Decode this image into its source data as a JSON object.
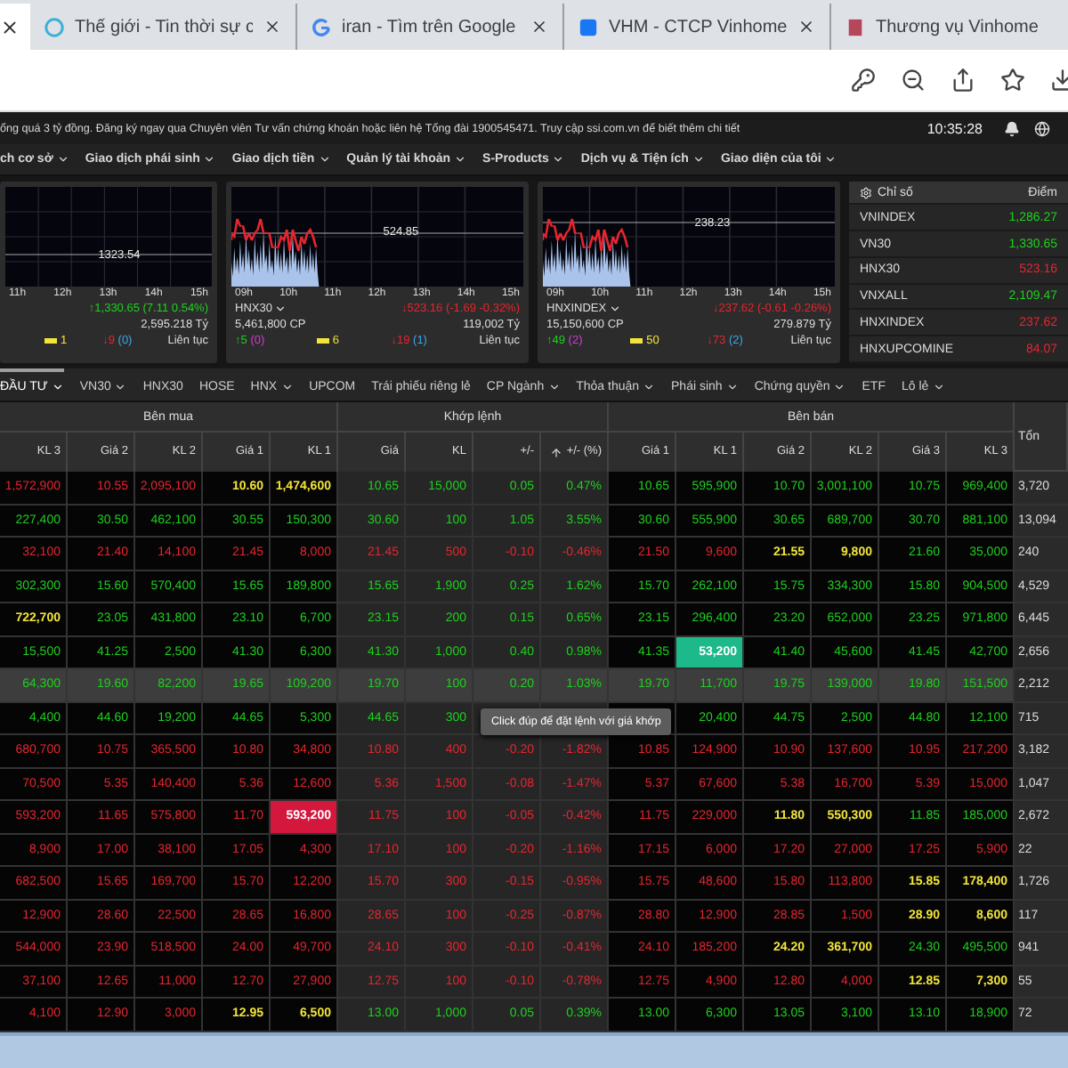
{
  "browser": {
    "tabs": [
      {
        "title": "Thế giới - Tin thời sự c"
      },
      {
        "title": "iran - Tìm trên Google"
      },
      {
        "title": "VHM - CTCP Vinhome"
      },
      {
        "title": "Thương vụ Vinhome"
      }
    ]
  },
  "ticker": {
    "text": "ổng quá 3 tỷ đồng. Đăng ký ngay qua Chuyên viên Tư vấn chứng khoán hoặc liên hệ Tổng đài 1900545471. Truy cập ssi.com.vn để biết thêm chi tiết",
    "time": "10:35:28"
  },
  "menu": [
    "ch cơ sở",
    "Giao dịch phái sinh",
    "Giao dịch tiền",
    "Quản lý tài khoản",
    "S-Products",
    "Dịch vụ & Tiện ích",
    "Giao diện của tôi"
  ],
  "charts": [
    {
      "reference": "1323.54",
      "hours": [
        "11h",
        "12h",
        "13h",
        "14h",
        "15h"
      ],
      "color": "#1fd01f",
      "change": "↑1,330.65 (7.11 0.54%)",
      "value": "2,595.218 Tỷ",
      "unchanged": "1",
      "declines": "↓9",
      "declines_floor": "(0)",
      "status": "Liên tục"
    },
    {
      "reference": "524.85",
      "hours": [
        "09h",
        "10h",
        "11h",
        "12h",
        "13h",
        "14h",
        "15h"
      ],
      "name": "HNX30",
      "color": "#e5262f",
      "change": "↓523.16 (-1.69 -0.32%)",
      "volume": "5,461,800 CP",
      "value": "119,002 Tỷ",
      "advances": "↑5",
      "advances_ceiling": "(0)",
      "unchanged": "6",
      "declines": "↓19",
      "declines_floor": "(1)",
      "status": "Liên tục"
    },
    {
      "reference": "238.23",
      "hours": [
        "09h",
        "10h",
        "11h",
        "12h",
        "13h",
        "14h",
        "15h"
      ],
      "name": "HNXINDEX",
      "color": "#e5262f",
      "change": "↓237.62 (-0.61 -0.26%)",
      "volume": "15,150,600 CP",
      "value": "279.879 Tỷ",
      "advances": "↑49",
      "advances_ceiling": "(2)",
      "unchanged": "50",
      "declines": "↓73",
      "declines_floor": "(2)",
      "status": "Liên tục"
    }
  ],
  "indices": {
    "header": [
      "Chỉ số",
      "Điểm"
    ],
    "rows": [
      {
        "name": "VNINDEX",
        "value": "1,286.27",
        "color": "#1fd01f"
      },
      {
        "name": "VN30",
        "value": "1,330.65",
        "color": "#1fd01f"
      },
      {
        "name": "HNX30",
        "value": "523.16",
        "color": "#e5262f"
      },
      {
        "name": "VNXALL",
        "value": "2,109.47",
        "color": "#1fd01f"
      },
      {
        "name": "HNXINDEX",
        "value": "237.62",
        "color": "#e5262f"
      },
      {
        "name": "HNXUPCOMINE",
        "value": "84.07",
        "color": "#e5262f"
      }
    ]
  },
  "board": {
    "tabs": [
      {
        "label": "ĐẦU TƯ",
        "dropdown": true,
        "selected": true
      },
      {
        "label": "VN30",
        "dropdown": true,
        "selected": false
      },
      {
        "label": "HNX30",
        "dropdown": false,
        "selected": false
      },
      {
        "label": "HOSE",
        "dropdown": false,
        "selected": false
      },
      {
        "label": "HNX",
        "dropdown": true,
        "selected": false
      },
      {
        "label": "UPCOM",
        "dropdown": false,
        "selected": false
      },
      {
        "label": "Trái phiếu riêng lẻ",
        "dropdown": false,
        "selected": false
      },
      {
        "label": "CP Ngành",
        "dropdown": true,
        "selected": false
      },
      {
        "label": "Thỏa thuận",
        "dropdown": true,
        "selected": false
      },
      {
        "label": "Phái sinh",
        "dropdown": true,
        "selected": false
      },
      {
        "label": "Chứng quyền",
        "dropdown": true,
        "selected": false
      },
      {
        "label": "ETF",
        "dropdown": false,
        "selected": false
      },
      {
        "label": "Lô lẻ",
        "dropdown": true,
        "selected": false
      }
    ],
    "groups": [
      "Bên mua",
      "Khớp lệnh",
      "Bên bán",
      "Tổn"
    ],
    "columns": [
      "KL 3",
      "Giá 2",
      "KL 2",
      "Giá 1",
      "KL 1",
      "Giá",
      "KL",
      "+/-",
      "+/- (%)",
      "Giá 1",
      "KL 1",
      "Giá 2",
      "KL 2",
      "Giá 3",
      "KL 3"
    ],
    "rows": [
      {
        "selected": false,
        "bid": [
          {
            "volume": "1,572,900",
            "color": "#e5262f"
          },
          {
            "price": "10.55",
            "volume": "2,095,100",
            "color": "#e5262f"
          },
          {
            "price": "10.60",
            "volume": "1,474,600",
            "color": "#f2e43a"
          }
        ],
        "match": {
          "price": "10.65",
          "volume": "15,000",
          "change": "0.05",
          "percent": "0.47%",
          "color": "#1fd01f"
        },
        "ask": [
          {
            "price": "10.65",
            "volume": "595,900",
            "color": "#1fd01f"
          },
          {
            "price": "10.70",
            "volume": "3,001,100",
            "color": "#1fd01f"
          },
          {
            "price": "10.75",
            "volume": "969,400",
            "color": "#1fd01f"
          }
        ],
        "total": "3,720"
      },
      {
        "selected": false,
        "bid": [
          {
            "volume": "227,400",
            "color": "#1fd01f"
          },
          {
            "price": "30.50",
            "volume": "462,100",
            "color": "#1fd01f"
          },
          {
            "price": "30.55",
            "volume": "150,300",
            "color": "#1fd01f"
          }
        ],
        "match": {
          "price": "30.60",
          "volume": "100",
          "change": "1.05",
          "percent": "3.55%",
          "color": "#1fd01f"
        },
        "ask": [
          {
            "price": "30.60",
            "volume": "555,900",
            "color": "#1fd01f"
          },
          {
            "price": "30.65",
            "volume": "689,700",
            "color": "#1fd01f"
          },
          {
            "price": "30.70",
            "volume": "881,100",
            "color": "#1fd01f"
          }
        ],
        "total": "13,094"
      },
      {
        "selected": false,
        "bid": [
          {
            "volume": "32,100",
            "color": "#e5262f"
          },
          {
            "price": "21.40",
            "volume": "14,100",
            "color": "#e5262f"
          },
          {
            "price": "21.45",
            "volume": "8,000",
            "color": "#e5262f"
          }
        ],
        "match": {
          "price": "21.45",
          "volume": "500",
          "change": "-0.10",
          "percent": "-0.46%",
          "color": "#e5262f"
        },
        "ask": [
          {
            "price": "21.50",
            "volume": "9,600",
            "color": "#e5262f"
          },
          {
            "price": "21.55",
            "volume": "9,800",
            "color": "#f2e43a"
          },
          {
            "price": "21.60",
            "volume": "35,000",
            "color": "#1fd01f"
          }
        ],
        "total": "240"
      },
      {
        "selected": false,
        "bid": [
          {
            "volume": "302,300",
            "color": "#1fd01f"
          },
          {
            "price": "15.60",
            "volume": "570,400",
            "color": "#1fd01f"
          },
          {
            "price": "15.65",
            "volume": "189,800",
            "color": "#1fd01f"
          }
        ],
        "match": {
          "price": "15.65",
          "volume": "1,900",
          "change": "0.25",
          "percent": "1.62%",
          "color": "#1fd01f"
        },
        "ask": [
          {
            "price": "15.70",
            "volume": "262,100",
            "color": "#1fd01f"
          },
          {
            "price": "15.75",
            "volume": "334,300",
            "color": "#1fd01f"
          },
          {
            "price": "15.80",
            "volume": "904,500",
            "color": "#1fd01f"
          }
        ],
        "total": "4,529"
      },
      {
        "selected": false,
        "bid": [
          {
            "volume": "722,700",
            "color": "#f2e43a"
          },
          {
            "price": "23.05",
            "volume": "431,800",
            "color": "#1fd01f"
          },
          {
            "price": "23.10",
            "volume": "6,700",
            "color": "#1fd01f"
          }
        ],
        "match": {
          "price": "23.15",
          "volume": "200",
          "change": "0.15",
          "percent": "0.65%",
          "color": "#1fd01f"
        },
        "ask": [
          {
            "price": "23.15",
            "volume": "296,400",
            "color": "#1fd01f"
          },
          {
            "price": "23.20",
            "volume": "652,000",
            "color": "#1fd01f"
          },
          {
            "price": "23.25",
            "volume": "971,800",
            "color": "#1fd01f"
          }
        ],
        "total": "6,445"
      },
      {
        "selected": false,
        "bid": [
          {
            "volume": "15,500",
            "color": "#1fd01f"
          },
          {
            "price": "41.25",
            "volume": "2,500",
            "color": "#1fd01f"
          },
          {
            "price": "41.30",
            "volume": "6,300",
            "color": "#1fd01f"
          }
        ],
        "match": {
          "price": "41.30",
          "volume": "1,000",
          "change": "0.40",
          "percent": "0.98%",
          "color": "#1fd01f"
        },
        "ask": [
          {
            "price": "41.35",
            "volume": "53,200",
            "color": "#1fd01f",
            "highlight": {
              "color": "#1db98b"
            }
          },
          {
            "price": "41.40",
            "volume": "45,600",
            "color": "#1fd01f"
          },
          {
            "price": "41.45",
            "volume": "42,700",
            "color": "#1fd01f"
          }
        ],
        "total": "2,656"
      },
      {
        "selected": true,
        "bid": [
          {
            "volume": "64,300",
            "color": "#1fd01f"
          },
          {
            "price": "19.60",
            "volume": "82,200",
            "color": "#1fd01f"
          },
          {
            "price": "19.65",
            "volume": "109,200",
            "color": "#1fd01f"
          }
        ],
        "match": {
          "price": "19.70",
          "volume": "100",
          "change": "0.20",
          "percent": "1.03%",
          "color": "#1fd01f"
        },
        "ask": [
          {
            "price": "19.70",
            "volume": "11,700",
            "color": "#1fd01f"
          },
          {
            "price": "19.75",
            "volume": "139,000",
            "color": "#1fd01f"
          },
          {
            "price": "19.80",
            "volume": "151,500",
            "color": "#1fd01f"
          }
        ],
        "total": "2,212"
      },
      {
        "selected": false,
        "tooltip": "Click đúp để đặt lệnh với giá khớp",
        "bid": [
          {
            "volume": "4,400",
            "color": "#1fd01f"
          },
          {
            "price": "44.60",
            "volume": "19,200",
            "color": "#1fd01f"
          },
          {
            "price": "44.65",
            "volume": "5,300",
            "color": "#1fd01f"
          }
        ],
        "match": {
          "price": "44.65",
          "volume": "300",
          "color": "#1fd01f"
        },
        "ask": [
          {
            "volume": "20,400",
            "color": "#1fd01f"
          },
          {
            "price": "44.75",
            "volume": "2,500",
            "color": "#1fd01f"
          },
          {
            "price": "44.80",
            "volume": "12,100",
            "color": "#1fd01f"
          }
        ],
        "total": "715"
      },
      {
        "selected": false,
        "bid": [
          {
            "volume": "680,700",
            "color": "#e5262f"
          },
          {
            "price": "10.75",
            "volume": "365,500",
            "color": "#e5262f"
          },
          {
            "price": "10.80",
            "volume": "34,800",
            "color": "#e5262f"
          }
        ],
        "match": {
          "price": "10.80",
          "volume": "400",
          "change": "-0.20",
          "percent": "-1.82%",
          "color": "#e5262f"
        },
        "ask": [
          {
            "price": "10.85",
            "volume": "124,900",
            "color": "#e5262f"
          },
          {
            "price": "10.90",
            "volume": "137,600",
            "color": "#e5262f"
          },
          {
            "price": "10.95",
            "volume": "217,200",
            "color": "#e5262f"
          }
        ],
        "total": "3,182"
      },
      {
        "selected": false,
        "bid": [
          {
            "volume": "70,500",
            "color": "#e5262f"
          },
          {
            "price": "5.35",
            "volume": "140,400",
            "color": "#e5262f"
          },
          {
            "price": "5.36",
            "volume": "12,600",
            "color": "#e5262f"
          }
        ],
        "match": {
          "price": "5.36",
          "volume": "1,500",
          "change": "-0.08",
          "percent": "-1.47%",
          "color": "#e5262f"
        },
        "ask": [
          {
            "price": "5.37",
            "volume": "67,600",
            "color": "#e5262f"
          },
          {
            "price": "5.38",
            "volume": "16,700",
            "color": "#e5262f"
          },
          {
            "price": "5.39",
            "volume": "15,000",
            "color": "#e5262f"
          }
        ],
        "total": "1,047"
      },
      {
        "selected": false,
        "bid": [
          {
            "volume": "593,200",
            "color": "#e5262f"
          },
          {
            "price": "11.65",
            "volume": "575,800",
            "color": "#e5262f"
          },
          {
            "price": "11.70",
            "volume": "593,200",
            "color": "#e5262f",
            "highlight": {
              "color": "#d3173d"
            }
          }
        ],
        "match": {
          "price": "11.75",
          "volume": "100",
          "change": "-0.05",
          "percent": "-0.42%",
          "color": "#e5262f"
        },
        "ask": [
          {
            "price": "11.75",
            "volume": "229,000",
            "color": "#e5262f"
          },
          {
            "price": "11.80",
            "volume": "550,300",
            "color": "#f2e43a"
          },
          {
            "price": "11.85",
            "volume": "185,000",
            "color": "#1fd01f"
          }
        ],
        "total": "2,672"
      },
      {
        "selected": false,
        "bid": [
          {
            "volume": "8,900",
            "color": "#e5262f"
          },
          {
            "price": "17.00",
            "volume": "38,100",
            "color": "#e5262f"
          },
          {
            "price": "17.05",
            "volume": "4,300",
            "color": "#e5262f"
          }
        ],
        "match": {
          "price": "17.10",
          "volume": "100",
          "change": "-0.20",
          "percent": "-1.16%",
          "color": "#e5262f"
        },
        "ask": [
          {
            "price": "17.15",
            "volume": "6,000",
            "color": "#e5262f"
          },
          {
            "price": "17.20",
            "volume": "27,000",
            "color": "#e5262f"
          },
          {
            "price": "17.25",
            "volume": "5,900",
            "color": "#e5262f"
          }
        ],
        "total": "22"
      },
      {
        "selected": false,
        "bid": [
          {
            "volume": "682,500",
            "color": "#e5262f"
          },
          {
            "price": "15.65",
            "volume": "169,700",
            "color": "#e5262f"
          },
          {
            "price": "15.70",
            "volume": "12,200",
            "color": "#e5262f"
          }
        ],
        "match": {
          "price": "15.70",
          "volume": "300",
          "change": "-0.15",
          "percent": "-0.95%",
          "color": "#e5262f"
        },
        "ask": [
          {
            "price": "15.75",
            "volume": "48,600",
            "color": "#e5262f"
          },
          {
            "price": "15.80",
            "volume": "113,800",
            "color": "#e5262f"
          },
          {
            "price": "15.85",
            "volume": "178,400",
            "color": "#f2e43a"
          }
        ],
        "total": "1,726"
      },
      {
        "selected": false,
        "bid": [
          {
            "volume": "12,900",
            "color": "#e5262f"
          },
          {
            "price": "28.60",
            "volume": "22,500",
            "color": "#e5262f"
          },
          {
            "price": "28.65",
            "volume": "16,800",
            "color": "#e5262f"
          }
        ],
        "match": {
          "price": "28.65",
          "volume": "100",
          "change": "-0.25",
          "percent": "-0.87%",
          "color": "#e5262f"
        },
        "ask": [
          {
            "price": "28.80",
            "volume": "12,900",
            "color": "#e5262f"
          },
          {
            "price": "28.85",
            "volume": "1,500",
            "color": "#e5262f"
          },
          {
            "price": "28.90",
            "volume": "8,600",
            "color": "#f2e43a"
          }
        ],
        "total": "117"
      },
      {
        "selected": false,
        "bid": [
          {
            "volume": "544,000",
            "color": "#e5262f"
          },
          {
            "price": "23.90",
            "volume": "518,500",
            "color": "#e5262f"
          },
          {
            "price": "24.00",
            "volume": "49,700",
            "color": "#e5262f"
          }
        ],
        "match": {
          "price": "24.10",
          "volume": "300",
          "change": "-0.10",
          "percent": "-0.41%",
          "color": "#e5262f"
        },
        "ask": [
          {
            "price": "24.10",
            "volume": "185,200",
            "color": "#e5262f"
          },
          {
            "price": "24.20",
            "volume": "361,700",
            "color": "#f2e43a"
          },
          {
            "price": "24.30",
            "volume": "495,500",
            "color": "#1fd01f"
          }
        ],
        "total": "941"
      },
      {
        "selected": false,
        "bid": [
          {
            "volume": "37,100",
            "color": "#e5262f"
          },
          {
            "price": "12.65",
            "volume": "11,000",
            "color": "#e5262f"
          },
          {
            "price": "12.70",
            "volume": "27,900",
            "color": "#e5262f"
          }
        ],
        "match": {
          "price": "12.75",
          "volume": "100",
          "change": "-0.10",
          "percent": "-0.78%",
          "color": "#e5262f"
        },
        "ask": [
          {
            "price": "12.75",
            "volume": "4,900",
            "color": "#e5262f"
          },
          {
            "price": "12.80",
            "volume": "4,000",
            "color": "#e5262f"
          },
          {
            "price": "12.85",
            "volume": "7,300",
            "color": "#f2e43a"
          }
        ],
        "total": "55"
      },
      {
        "selected": false,
        "bid": [
          {
            "volume": "4,100",
            "color": "#e5262f"
          },
          {
            "price": "12.90",
            "volume": "3,000",
            "color": "#e5262f"
          },
          {
            "price": "12.95",
            "volume": "6,500",
            "color": "#f2e43a"
          }
        ],
        "match": {
          "price": "13.00",
          "volume": "1,000",
          "change": "0.05",
          "percent": "0.39%",
          "color": "#1fd01f"
        },
        "ask": [
          {
            "price": "13.00",
            "volume": "6,300",
            "color": "#1fd01f"
          },
          {
            "price": "13.05",
            "volume": "3,100",
            "color": "#1fd01f"
          },
          {
            "price": "13.10",
            "volume": "18,900",
            "color": "#1fd01f"
          }
        ],
        "total": "72"
      }
    ]
  }
}
